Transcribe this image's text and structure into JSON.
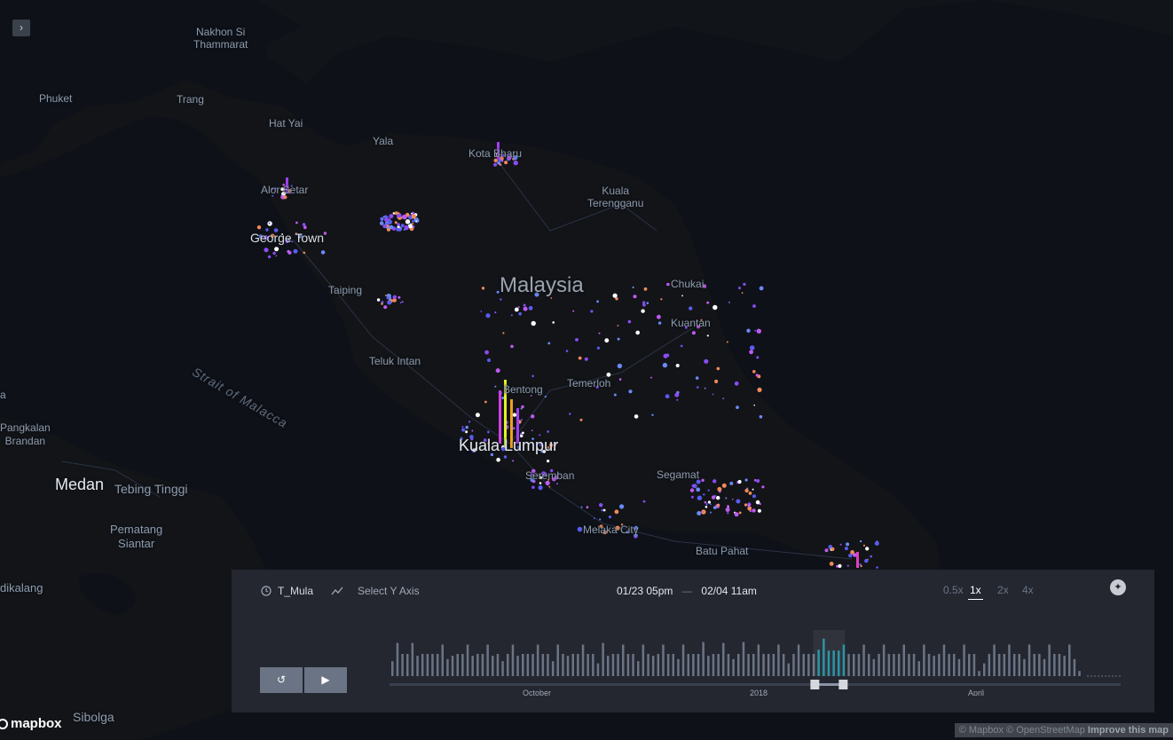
{
  "map": {
    "places": [
      {
        "name": "Nakhon Si\nThammarat",
        "style": "town"
      },
      {
        "name": "Phuket",
        "style": "town"
      },
      {
        "name": "Trang",
        "style": "town"
      },
      {
        "name": "Hat Yai",
        "style": "town"
      },
      {
        "name": "Yala",
        "style": "town"
      },
      {
        "name": "Kota Bharu",
        "style": "town"
      },
      {
        "name": "Kuala\nTerengganu",
        "style": "town"
      },
      {
        "name": "Alor Setar",
        "style": "town"
      },
      {
        "name": "George Town",
        "style": "med"
      },
      {
        "name": "Taiping",
        "style": "town"
      },
      {
        "name": "Malaysia",
        "style": "country"
      },
      {
        "name": "Chukai",
        "style": "town"
      },
      {
        "name": "Kuantan",
        "style": "town"
      },
      {
        "name": "Teluk Intan",
        "style": "town"
      },
      {
        "name": "Bentong",
        "style": "town"
      },
      {
        "name": "Temerloh",
        "style": "town"
      },
      {
        "name": "Kuala Lumpur",
        "style": "big"
      },
      {
        "name": "Seremban",
        "style": "town"
      },
      {
        "name": "Segamat",
        "style": "town"
      },
      {
        "name": "Melaka City",
        "style": "town"
      },
      {
        "name": "Batu Pahat",
        "style": "town"
      },
      {
        "name": "Pangkalan\nBrandan",
        "style": "town"
      },
      {
        "name": "Medan",
        "style": "big"
      },
      {
        "name": "Tebing Tinggi",
        "style": "town"
      },
      {
        "name": "Pematang\nSiantar",
        "style": "town"
      },
      {
        "name": "dikalang",
        "style": "town"
      },
      {
        "name": "Sibolga",
        "style": "town"
      },
      {
        "name": "a",
        "style": "town"
      },
      {
        "name": "Strait of Malacca",
        "style": "sea"
      }
    ]
  },
  "sidebar_toggle": {
    "icon": "chevron-right-icon",
    "label": "›"
  },
  "attribution": {
    "logo": "mapbox",
    "prefix": "© Mapbox © OpenStreetMap",
    "improve": "Improve this map"
  },
  "timeline": {
    "field": "T_Mula",
    "field_icon": "clock-icon",
    "y_axis_placeholder": "Select Y Axis",
    "y_axis_icon": "line-chart-icon",
    "range_start": "01/23 05pm",
    "range_separator": "—",
    "range_end": "02/04 11am",
    "speeds": [
      "0.5x",
      "1x",
      "2x",
      "4x"
    ],
    "active_speed": "1x",
    "reset_icon": "reset-icon",
    "play_icon": "play-icon",
    "corner_icon": "info-icon",
    "axis_labels": [
      "October",
      "2018",
      "April"
    ],
    "colors": {
      "bar": "#6a7485",
      "selected_bar": "#1f8fa0",
      "panel": "#242730",
      "track": "#3a4050",
      "handle": "#d5d9de"
    }
  },
  "chart_data": {
    "type": "bar",
    "title": "",
    "xlabel": "",
    "ylabel": "",
    "x_ticks": [
      "October",
      "2018",
      "April"
    ],
    "values": [
      0.35,
      0.78,
      0.52,
      0.52,
      0.78,
      0.48,
      0.52,
      0.52,
      0.52,
      0.52,
      0.74,
      0.4,
      0.48,
      0.52,
      0.52,
      0.74,
      0.48,
      0.52,
      0.52,
      0.74,
      0.48,
      0.52,
      0.35,
      0.52,
      0.74,
      0.48,
      0.52,
      0.52,
      0.52,
      0.74,
      0.52,
      0.52,
      0.35,
      0.74,
      0.52,
      0.48,
      0.52,
      0.52,
      0.74,
      0.52,
      0.52,
      0.3,
      0.78,
      0.48,
      0.52,
      0.52,
      0.74,
      0.52,
      0.52,
      0.35,
      0.74,
      0.52,
      0.48,
      0.52,
      0.74,
      0.52,
      0.52,
      0.4,
      0.74,
      0.52,
      0.52,
      0.52,
      0.8,
      0.48,
      0.52,
      0.52,
      0.78,
      0.52,
      0.4,
      0.52,
      0.8,
      0.52,
      0.52,
      0.74,
      0.52,
      0.52,
      0.52,
      0.74,
      0.52,
      0.3,
      0.52,
      0.74,
      0.52,
      0.52,
      0.52,
      0.62,
      0.88,
      0.6,
      0.6,
      0.6,
      0.74,
      0.52,
      0.52,
      0.52,
      0.74,
      0.52,
      0.4,
      0.52,
      0.74,
      0.52,
      0.52,
      0.52,
      0.74,
      0.52,
      0.52,
      0.35,
      0.74,
      0.52,
      0.48,
      0.52,
      0.74,
      0.52,
      0.52,
      0.4,
      0.74,
      0.52,
      0.52,
      0.12,
      0.3,
      0.52,
      0.74,
      0.52,
      0.52,
      0.74,
      0.52,
      0.52,
      0.4,
      0.74,
      0.52,
      0.52,
      0.4,
      0.74,
      0.52,
      0.52,
      0.48,
      0.74,
      0.4,
      0.12
    ],
    "selected_range": [
      0.612,
      0.653
    ]
  }
}
